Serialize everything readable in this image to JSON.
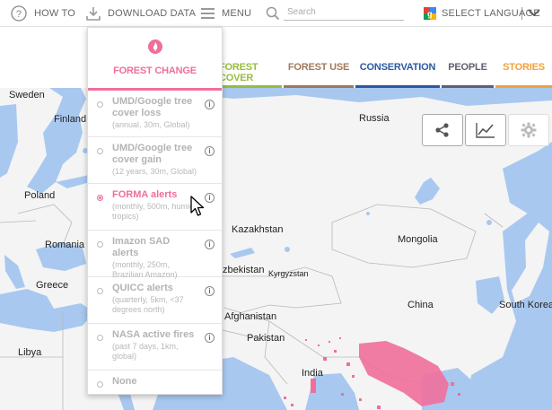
{
  "topbar": {
    "how_to": "HOW TO",
    "download": "DOWNLOAD DATA",
    "menu": "MENU",
    "search_placeholder": "Search",
    "language": "SELECT LANGUAGE"
  },
  "nav": {
    "tabs": [
      {
        "label": "FOREST COVER",
        "color": "#97bd3d"
      },
      {
        "label": "FOREST USE",
        "color": "#a1795a"
      },
      {
        "label": "CONSERVATION",
        "color": "#2a5aa0"
      },
      {
        "label": "PEOPLE",
        "color": "#606070"
      },
      {
        "label": "STORIES",
        "color": "#f0a23a"
      }
    ]
  },
  "dropdown": {
    "title": "FOREST CHANGE",
    "accent": "#ef6f9b",
    "items": [
      {
        "title": "UMD/Google tree cover loss",
        "sub": "(annual, 30m, Global)",
        "active": false
      },
      {
        "title": "UMD/Google tree cover gain",
        "sub": "(12 years, 30m, Global)",
        "active": false
      },
      {
        "title": "FORMA alerts",
        "sub": "(monthly, 500m, humid tropics)",
        "active": true
      },
      {
        "title": "Imazon SAD alerts",
        "sub": "(monthly, 250m, Brazilian Amazon)",
        "active": false
      },
      {
        "title": "QUICC alerts",
        "sub": "(quarterly, 5km, <37 degrees north)",
        "active": false
      },
      {
        "title": "NASA active fires",
        "sub": "(past 7 days, 1km, global)",
        "active": false
      },
      {
        "title": "None",
        "sub": "",
        "active": false
      }
    ],
    "info_glyph": "i"
  },
  "map": {
    "labels": {
      "sweden": "Sweden",
      "finland": "Finland",
      "russia": "Russia",
      "poland": "Poland",
      "kazakhstan": "Kazakhstan",
      "mongolia": "Mongolia",
      "romania": "Romania",
      "uzbekistan": "zbekistan",
      "kyrgyzstan": "Kyrgyzstan",
      "greece": "Greece",
      "afghanistan": "Afghanistan",
      "china": "China",
      "south_korea": "South Korea",
      "pakistan": "Pakistan",
      "libya": "Libya",
      "india": "India"
    }
  },
  "map_controls": [
    "share-icon",
    "chart-icon",
    "settings-icon"
  ]
}
